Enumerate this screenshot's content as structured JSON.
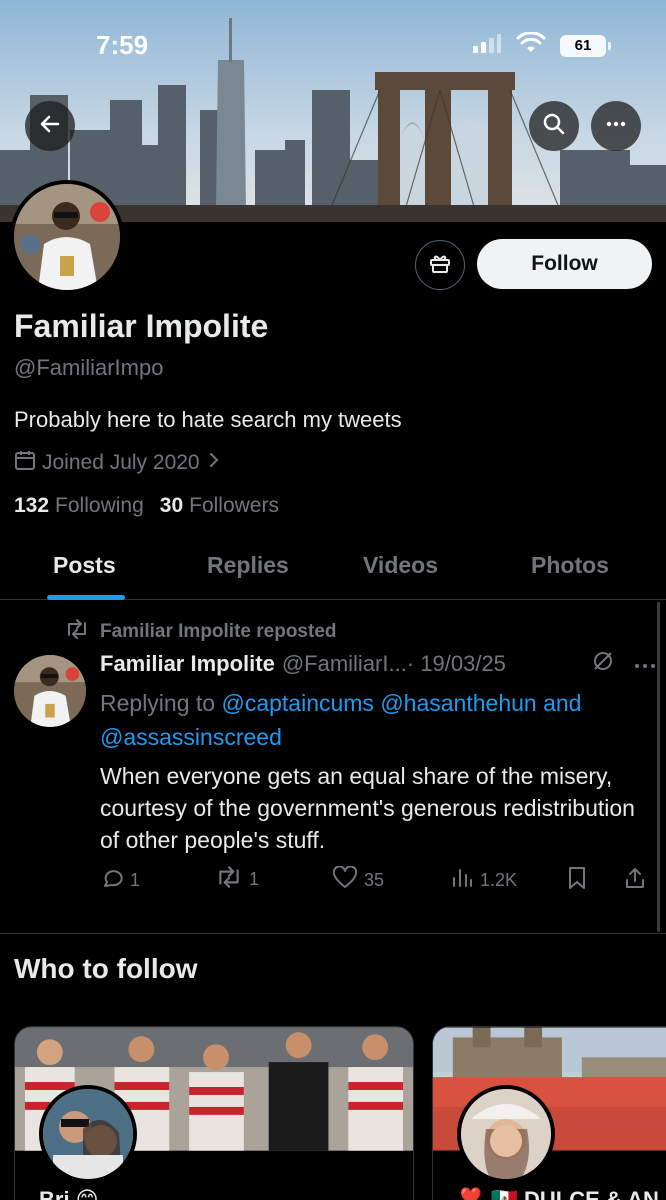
{
  "status_bar": {
    "time": "7:59",
    "battery": "61"
  },
  "profile": {
    "name": "Familiar Impolite",
    "handle": "@FamiliarImpo",
    "bio": "Probably here to hate search my tweets",
    "joined": "Joined July 2020",
    "following_count": "132",
    "following_label": "Following",
    "followers_count": "30",
    "followers_label": "Followers",
    "follow_label": "Follow"
  },
  "tabs": [
    {
      "label": "Posts",
      "active": true
    },
    {
      "label": "Replies"
    },
    {
      "label": "Videos"
    },
    {
      "label": "Photos"
    }
  ],
  "post": {
    "repost_label": "Familiar Impolite reposted",
    "author_name": "Familiar Impolite",
    "author_handle": "@FamiliarI...",
    "date": "· 19/03/25",
    "replying_prefix": "Replying to",
    "mention1": "@captaincums",
    "mention2": "@hasanthehun",
    "and_text": "and",
    "mention3": "@assassinscreed",
    "text": "When everyone gets an equal share of the misery, courtesy of the government's generous redistribution of other people's stuff.",
    "replies": "1",
    "reposts": "1",
    "likes": "35",
    "views": "1.2K"
  },
  "who_to_follow": {
    "title": "Who to follow",
    "cards": [
      {
        "name": "Bri 😊"
      },
      {
        "name": "❣️ 🇲🇽 DULCE & AN"
      }
    ]
  },
  "colors": {
    "accent": "#1d9bf0",
    "muted": "#71767b",
    "text": "#e7e9ea",
    "bg": "#000000"
  }
}
